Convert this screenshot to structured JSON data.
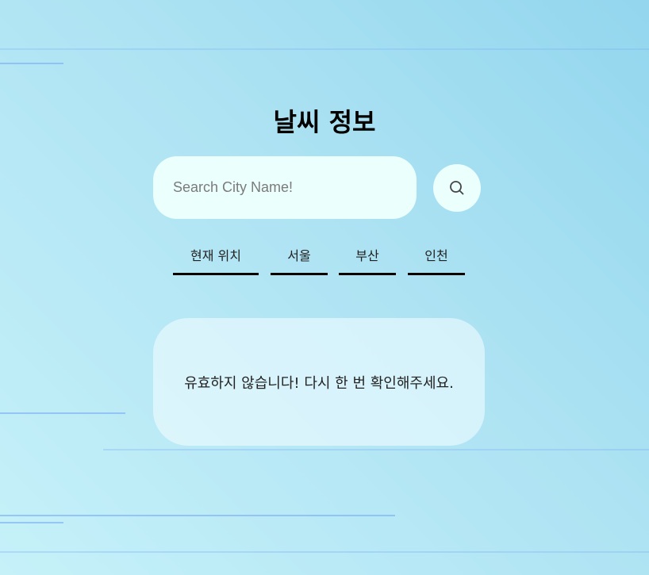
{
  "header": {
    "title": "날씨 정보"
  },
  "search": {
    "placeholder": "Search City Name!",
    "value": "",
    "button_icon": "search-icon"
  },
  "city_tabs": [
    {
      "label": "현재 위치"
    },
    {
      "label": "서울"
    },
    {
      "label": "부산"
    },
    {
      "label": "인천"
    }
  ],
  "result": {
    "message": "유효하지 않습니다! 다시 한 번 확인해주세요."
  },
  "colors": {
    "background_start": "#93d6ee",
    "background_end": "#c6f1f9",
    "input_background": "#ebfffd",
    "deco_line": "#78aaf5"
  }
}
